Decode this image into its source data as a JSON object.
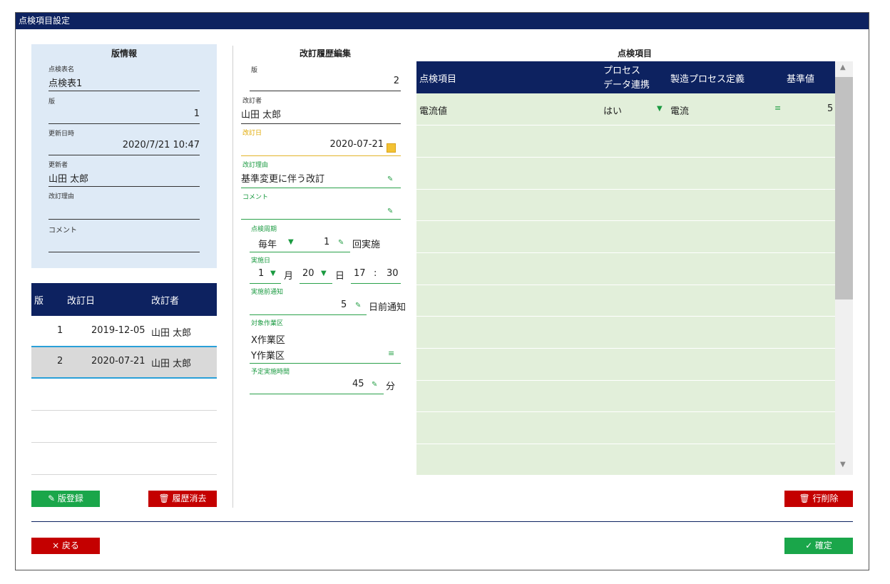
{
  "window": {
    "title": "点検項目設定"
  },
  "version_info": {
    "title": "版情報",
    "sheet_name_label": "点検表名",
    "sheet_name": "点検表1",
    "version_label": "版",
    "version": "1",
    "updated_at_label": "更新日時",
    "updated_at": "2020/7/21 10:47",
    "updated_by_label": "更新者",
    "updated_by": "山田 太郎",
    "reason_label": "改訂理由",
    "reason": "",
    "comment_label": "コメント",
    "comment": ""
  },
  "revision_table": {
    "columns": [
      "版",
      "改訂日",
      "改訂者"
    ],
    "rows": [
      {
        "version": "1",
        "date": "2019-12-05",
        "author": "山田 太郎"
      },
      {
        "version": "2",
        "date": "2020-07-21",
        "author": "山田 太郎"
      }
    ]
  },
  "left_buttons": {
    "register": "✎ 版登録",
    "delete_history": "🗑 履歴消去"
  },
  "edit": {
    "title": "改訂履歴編集",
    "version_label": "版",
    "version": "2",
    "reviser_label": "改訂者",
    "reviser": "山田 太郎",
    "date_label": "改訂日",
    "date": "2020-07-21",
    "reason_label": "改訂理由",
    "reason": "基準変更に伴う改訂",
    "comment_label": "コメント",
    "comment": "",
    "cycle_label": "点検周期",
    "cycle_unit": "毎年",
    "cycle_count": "1",
    "cycle_suffix": "回実施",
    "exec_label": "実施日",
    "exec_month": "1",
    "month_suffix": "月",
    "exec_day": "20",
    "day_suffix": "日",
    "exec_hour": "17",
    "time_sep": ":",
    "exec_min": "30",
    "notice_label": "実施前通知",
    "notice_days": "5",
    "notice_suffix": "日前通知",
    "area_label": "対象作業区",
    "area_1": "X作業区",
    "area_2": "Y作業区",
    "duration_label": "予定実施時間",
    "duration": "45",
    "duration_suffix": "分"
  },
  "items": {
    "title": "点検項目",
    "columns": {
      "item": "点検項目",
      "process_1": "プロセス",
      "process_2": "データ連携",
      "def": "製造プロセス定義",
      "std": "基準値"
    },
    "rows": [
      {
        "item": "電流値",
        "process": "はい",
        "def": "電流",
        "std": "5"
      }
    ]
  },
  "row_delete_label": "🗑 行削除",
  "back_label": "× 戻る",
  "confirm_label": "✓ 確定",
  "colors": {
    "navy": "#0d2260",
    "green": "#1aa64a",
    "red": "#c40000",
    "grid_bg": "#e2efda",
    "panel_bg": "#deeaf6"
  }
}
